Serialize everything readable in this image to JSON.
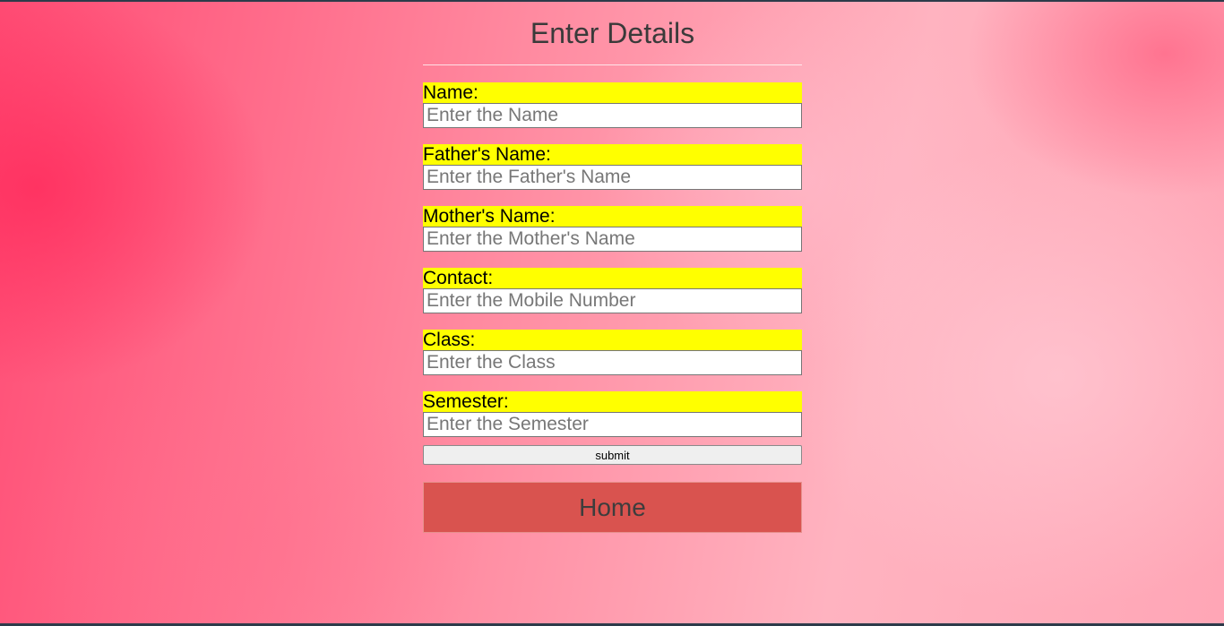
{
  "page": {
    "title": "Enter Details"
  },
  "form": {
    "fields": [
      {
        "label": "Name:",
        "placeholder": "Enter the Name",
        "value": ""
      },
      {
        "label": "Father's Name:",
        "placeholder": "Enter the Father's Name",
        "value": ""
      },
      {
        "label": "Mother's Name:",
        "placeholder": "Enter the Mother's Name",
        "value": ""
      },
      {
        "label": "Contact:",
        "placeholder": "Enter the Mobile Number",
        "value": ""
      },
      {
        "label": "Class:",
        "placeholder": "Enter the Class",
        "value": ""
      },
      {
        "label": "Semester:",
        "placeholder": "Enter the Semester",
        "value": ""
      }
    ],
    "submit_label": "submit"
  },
  "home_label": "Home",
  "colors": {
    "label_background": "#ffff00",
    "home_button": "#d9534f",
    "background_accent": "#ff4c74"
  }
}
